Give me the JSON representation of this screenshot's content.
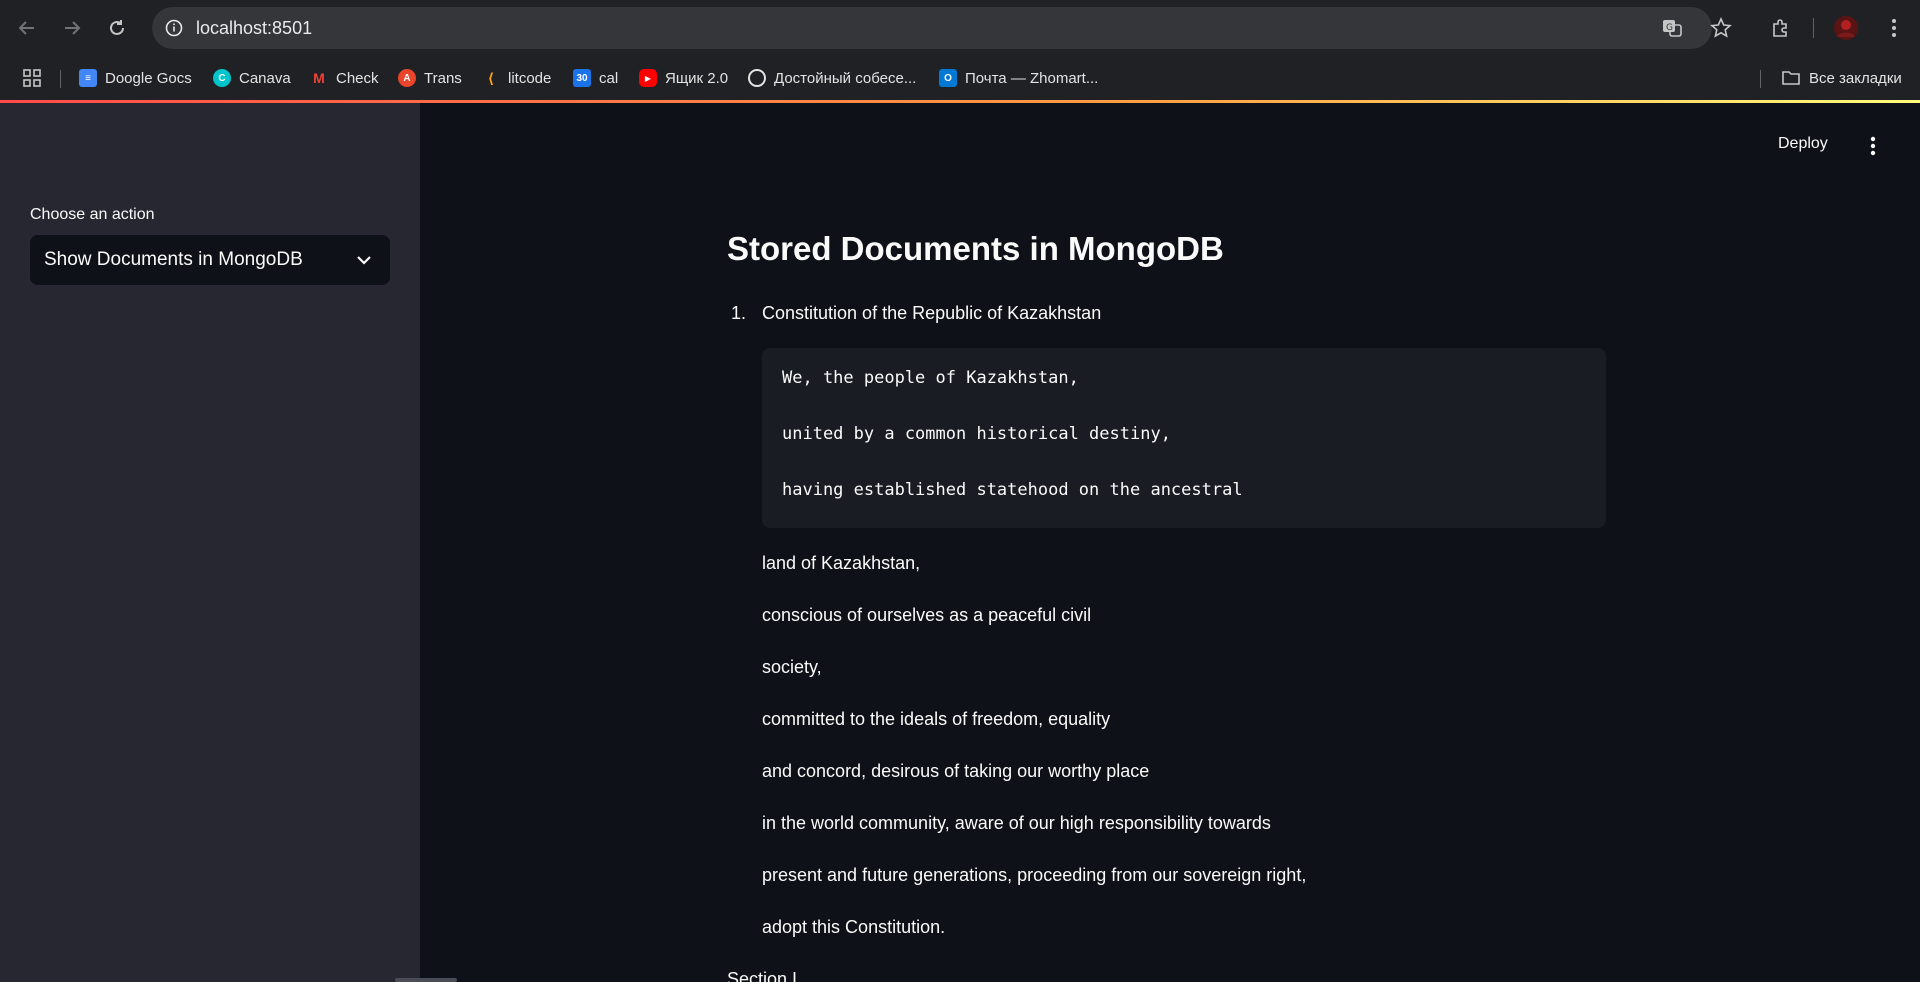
{
  "browser": {
    "url": "localhost:8501",
    "bookmarks": [
      {
        "label": "Doogle Gocs",
        "icon": "google-docs-icon",
        "color": "#4285f4"
      },
      {
        "label": "Canava",
        "icon": "canva-icon",
        "color": "#00c4cc"
      },
      {
        "label": "Check",
        "icon": "gmail-icon",
        "color": "#ea4335"
      },
      {
        "label": "Trans",
        "icon": "translate-icon",
        "color": "#e8452c"
      },
      {
        "label": "litcode",
        "icon": "leetcode-icon",
        "color": "#ffa116"
      },
      {
        "label": "cal",
        "icon": "calendar-icon",
        "color": "#1a73e8"
      },
      {
        "label": "Ящик 2.0",
        "icon": "youtube-icon",
        "color": "#ff0000"
      },
      {
        "label": "Достойный собесе...",
        "icon": "openai-icon",
        "color": "#ffffff"
      },
      {
        "label": "Почта — Zhomart...",
        "icon": "outlook-icon",
        "color": "#0078d4"
      }
    ],
    "all_bookmarks": "Все закладки"
  },
  "sidebar": {
    "label": "Choose an action",
    "select_value": "Show Documents in MongoDB"
  },
  "header": {
    "deploy": "Deploy"
  },
  "main": {
    "title": "Stored Documents in MongoDB",
    "documents": [
      {
        "number": "1.",
        "title": "Constitution of the Republic of Kazakhstan",
        "code_lines": [
          "We, the people of Kazakhstan,",
          "united by a common historical destiny,",
          "having established statehood on the ancestral"
        ],
        "paragraphs": [
          "land of Kazakhstan,",
          "conscious of ourselves as a peaceful civil",
          "society,",
          "committed to the ideals of freedom, equality",
          "and concord, desirous of taking our worthy place",
          "in the world community, aware of our high responsibility towards",
          "present and future generations, proceeding from our sovereign right,",
          "adopt this Constitution."
        ]
      }
    ],
    "section_heading": "Section I"
  },
  "colors": {
    "app_bg": "#0e1117",
    "sidebar_bg": "#262730",
    "code_bg": "#1a1c24",
    "text": "#fafafa",
    "accent": "#ff4b4b"
  }
}
